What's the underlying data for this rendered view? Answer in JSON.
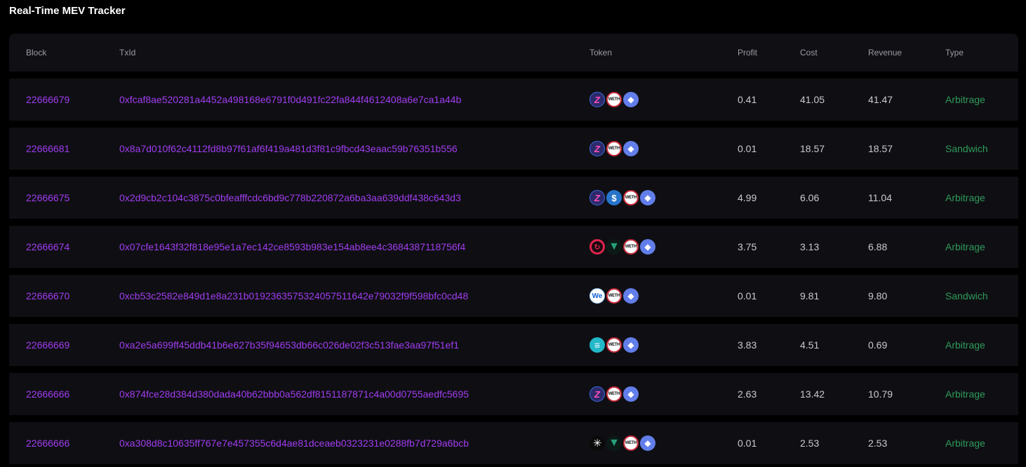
{
  "page": {
    "title": "Real-Time MEV Tracker"
  },
  "table": {
    "headers": {
      "block": "Block",
      "txid": "TxId",
      "token": "Token",
      "profit": "Profit",
      "cost": "Cost",
      "revenue": "Revenue",
      "type": "Type"
    },
    "rows": [
      {
        "block": "22666679",
        "txid": "0xfcaf8ae520281a4452a498168e6791f0d491fc22fa844f4612408a6e7ca1a44b",
        "tokens": [
          "z-token-icon",
          "weth-icon",
          "eth-icon"
        ],
        "profit": "0.41",
        "cost": "41.05",
        "revenue": "41.47",
        "type": "Arbitrage"
      },
      {
        "block": "22666681",
        "txid": "0x8a7d010f62c4112fd8b97f61af6f419a481d3f81c9fbcd43eaac59b76351b556",
        "tokens": [
          "z-token-icon",
          "weth-icon",
          "eth-icon"
        ],
        "profit": "0.01",
        "cost": "18.57",
        "revenue": "18.57",
        "type": "Sandwich"
      },
      {
        "block": "22666675",
        "txid": "0x2d9cb2c104c3875c0bfeafffcdc6bd9c778b220872a6ba3aa639ddf438c643d3",
        "tokens": [
          "z-token-icon",
          "usdc-icon",
          "weth-icon",
          "eth-icon"
        ],
        "profit": "4.99",
        "cost": "6.06",
        "revenue": "11.04",
        "type": "Arbitrage"
      },
      {
        "block": "22666674",
        "txid": "0x07cfe1643f32f818e95e1a7ec142ce8593b983e154ab8ee4c3684387118756f4",
        "tokens": [
          "ring-token-icon",
          "tether-icon",
          "weth-icon",
          "eth-icon"
        ],
        "profit": "3.75",
        "cost": "3.13",
        "revenue": "6.88",
        "type": "Arbitrage"
      },
      {
        "block": "22666670",
        "txid": "0xcb53c2582e849d1e8a231b019236357532405751164​2e79032f9f598bfc0cd48",
        "tokens": [
          "we-token-icon",
          "weth-icon",
          "eth-icon"
        ],
        "profit": "0.01",
        "cost": "9.81",
        "revenue": "9.80",
        "type": "Sandwich"
      },
      {
        "block": "22666669",
        "txid": "0xa2e5a699ff45ddb41b6e627b35f94653db66c026de02f3c513fae3aa97f51ef1",
        "tokens": [
          "e-token-icon",
          "weth-icon",
          "eth-icon"
        ],
        "profit": "3.83",
        "cost": "4.51",
        "revenue": "0.69",
        "type": "Arbitrage"
      },
      {
        "block": "22666666",
        "txid": "0x874fce28d384d380dada40b62bbb0a562df8151187871c4a00d0755aedfc5695",
        "tokens": [
          "z-token-icon",
          "weth-icon",
          "eth-icon"
        ],
        "profit": "2.63",
        "cost": "13.42",
        "revenue": "10.79",
        "type": "Arbitrage"
      },
      {
        "block": "22666666",
        "txid": "0xa308d8c10635ff767e7e457355c6d4ae81dceaeb0323231e0288fb7d729a6bcb",
        "tokens": [
          "star-token-icon",
          "tether-icon",
          "weth-icon",
          "eth-icon"
        ],
        "profit": "0.01",
        "cost": "2.53",
        "revenue": "2.53",
        "type": "Arbitrage"
      }
    ]
  },
  "colors": {
    "background": "#000000",
    "row_bg": "#0f0f13",
    "link": "#a13cf0",
    "type_green": "#2e9a5a"
  }
}
